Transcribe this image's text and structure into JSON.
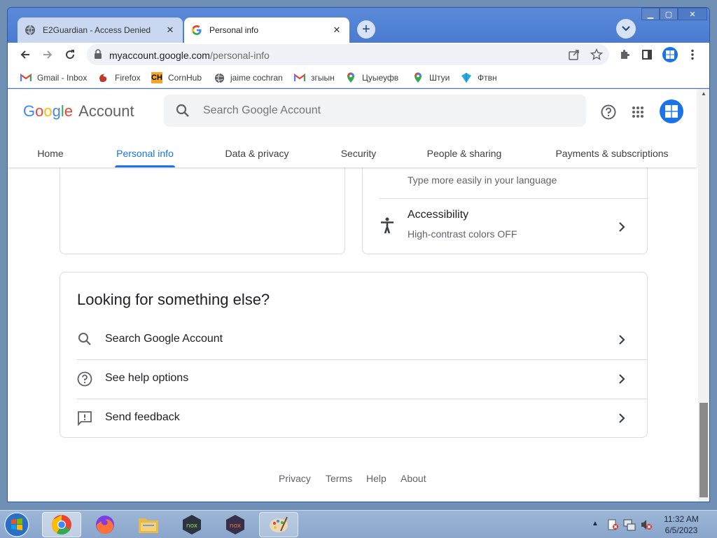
{
  "browser": {
    "tabs": [
      {
        "title": "E2Guardian - Access Denied"
      },
      {
        "title": "Personal info"
      }
    ],
    "url_host": "myaccount.google.com",
    "url_path": "/personal-info",
    "bookmarks": [
      {
        "label": "Gmail - Inbox",
        "icon": "gmail-icon"
      },
      {
        "label": "Firefox",
        "icon": "firefox-icon"
      },
      {
        "label": "CornHub",
        "icon": "ch-icon"
      },
      {
        "label": "jaime cochran",
        "icon": "globe-icon"
      },
      {
        "label": "згыын",
        "icon": "gmail-icon"
      },
      {
        "label": "Цуыеуфв",
        "icon": "maps-icon"
      },
      {
        "label": "Штуи",
        "icon": "maps-icon"
      },
      {
        "label": "Фтвн",
        "icon": "arrow-icon"
      }
    ]
  },
  "account": {
    "logo_google": "Google",
    "logo_account": "Account",
    "search_placeholder": "Search Google Account",
    "nav": [
      "Home",
      "Personal info",
      "Data & privacy",
      "Security",
      "People & sharing",
      "Payments & subscriptions"
    ],
    "active_nav": "Personal info"
  },
  "prefs": {
    "input_sub": "Type more easily in your language",
    "accessibility_title": "Accessibility",
    "accessibility_sub": "High-contrast colors OFF"
  },
  "looking": {
    "heading": "Looking for something else?",
    "items": [
      {
        "label": "Search Google Account",
        "icon": "search-icon"
      },
      {
        "label": "See help options",
        "icon": "help-icon"
      },
      {
        "label": "Send feedback",
        "icon": "feedback-icon"
      }
    ]
  },
  "footer": {
    "links": [
      "Privacy",
      "Terms",
      "Help",
      "About"
    ]
  },
  "taskbar": {
    "time": "11:32 AM",
    "date": "6/5/2023"
  },
  "colors": {
    "accent": "#1a73e8",
    "google_blue": "#4285f4",
    "google_red": "#ea4335",
    "google_yellow": "#fbbc05",
    "google_green": "#34a853"
  }
}
